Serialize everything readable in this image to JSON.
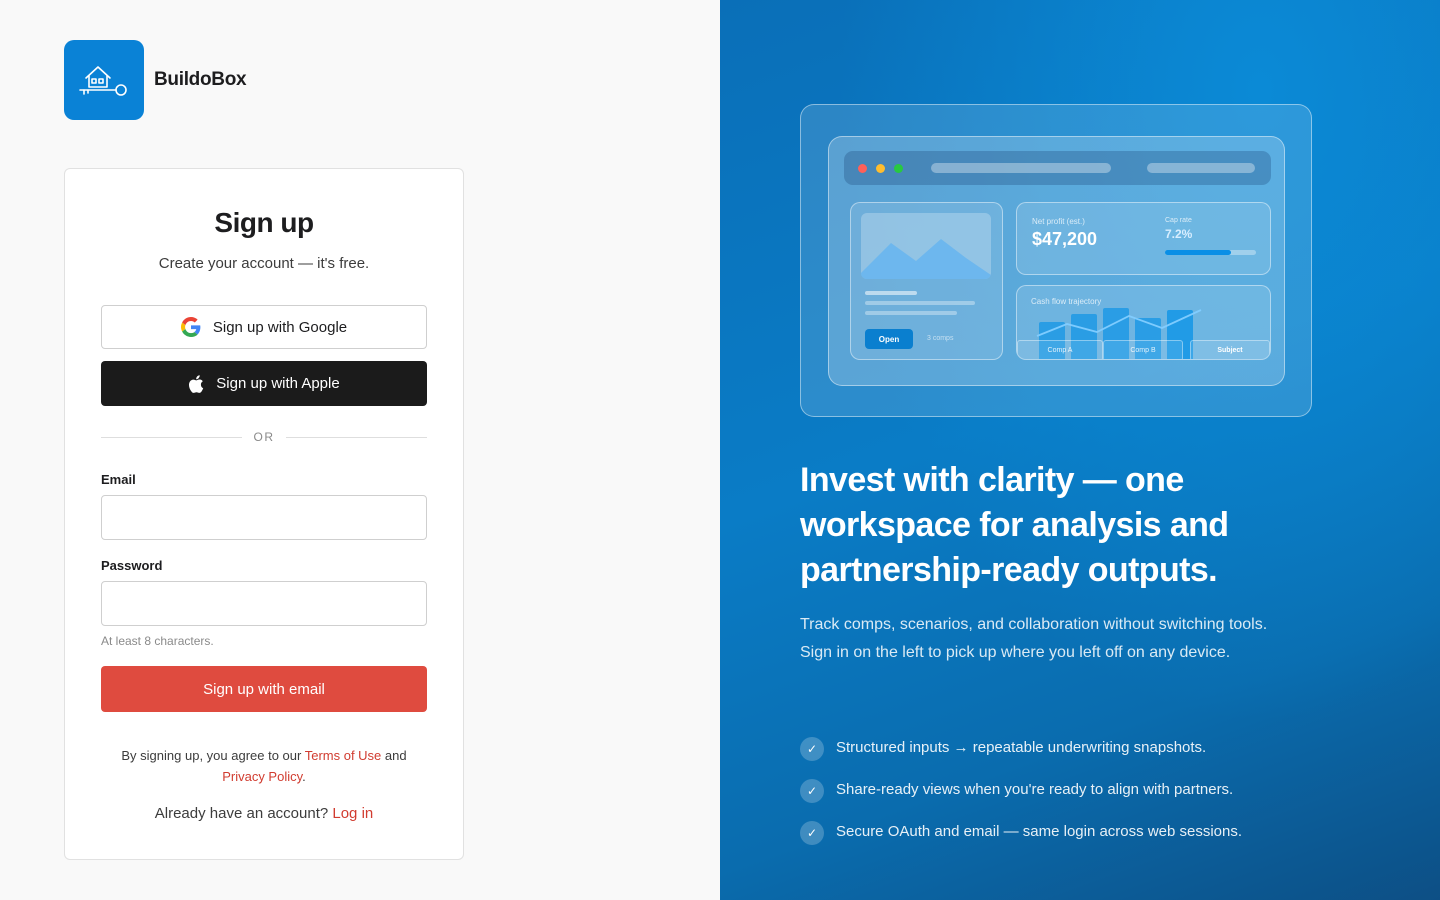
{
  "brand": {
    "name": "BuildoBox",
    "logo_icon": "house-key-icon",
    "color": "#0a82d6"
  },
  "signup": {
    "title": "Sign up",
    "subtitle": "Create your account — it's free.",
    "google_label": "Sign up with Google",
    "apple_label": "Sign up with Apple",
    "divider": "OR",
    "email_label": "Email",
    "email_value": "",
    "password_label": "Password",
    "password_value": "",
    "password_hint": "At least 8 characters.",
    "submit_label": "Sign up with email",
    "terms_prefix": "By signing up, you agree to our ",
    "terms_link": "Terms of Use",
    "terms_mid": " and ",
    "privacy_link": "Privacy Policy",
    "terms_suffix": ".",
    "login_prompt": "Already have an account? ",
    "login_link": "Log in",
    "accent_color": "#df4b3f"
  },
  "preview": {
    "net_profit_label": "Net profit (est.)",
    "net_profit_value": "$47,200",
    "cap_rate_label": "Cap rate",
    "cap_rate_value": "7.2%",
    "cap_rate_fill": 0.72,
    "open_button": "Open",
    "comps_note": "3 comps",
    "cashflow_label": "Cash flow trajectory",
    "tabs": [
      "Comp A",
      "Comp B",
      "Subject"
    ]
  },
  "marketing": {
    "headline": "Invest with clarity — one workspace for analysis and partnership-ready outputs.",
    "lead": "Track comps, scenarios, and collaboration without switching tools. Sign in on the left to pick up where you left off on any device.",
    "features": [
      "Structured inputs → repeatable underwriting snapshots.",
      "Share-ready views when you're ready to align with partners.",
      "Secure OAuth and email — same login across web sessions."
    ]
  }
}
